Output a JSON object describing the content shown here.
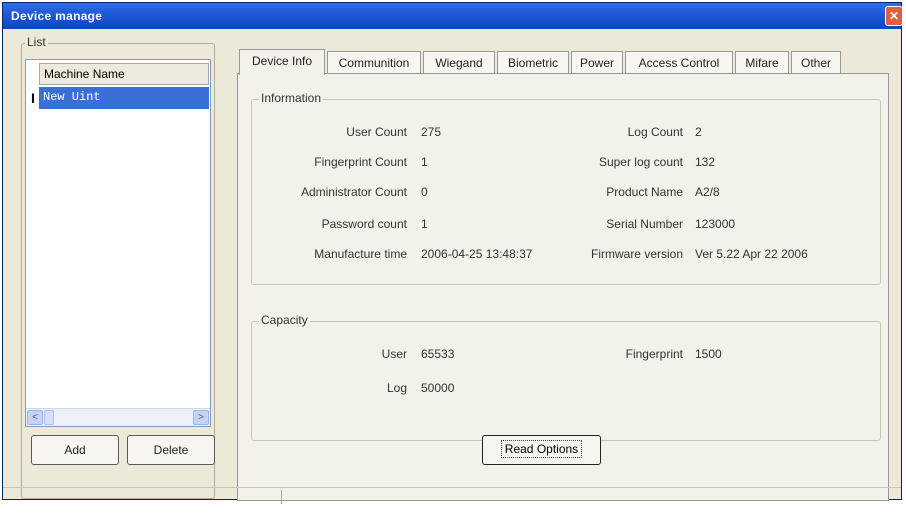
{
  "window": {
    "title": "Device manage",
    "close_glyph": "✕"
  },
  "list": {
    "legend": "List",
    "column_header": "Machine Name",
    "items": [
      {
        "label": "New Uint",
        "selected": true,
        "marker": "I"
      }
    ],
    "scroll_left": "<",
    "scroll_right": ">",
    "add_label": "Add",
    "delete_label": "Delete"
  },
  "tabs": [
    {
      "label": "Device Info",
      "active": true
    },
    {
      "label": "Communition",
      "active": false
    },
    {
      "label": "Wiegand",
      "active": false
    },
    {
      "label": "Biometric",
      "active": false
    },
    {
      "label": "Power",
      "active": false
    },
    {
      "label": "Access Control",
      "active": false
    },
    {
      "label": "Mifare",
      "active": false
    },
    {
      "label": "Other",
      "active": false
    }
  ],
  "information": {
    "legend": "Information",
    "user_count": {
      "label": "User Count",
      "value": "275"
    },
    "fingerprint_count": {
      "label": "Fingerprint Count",
      "value": "1"
    },
    "administrator_count": {
      "label": "Administrator Count",
      "value": "0"
    },
    "password_count": {
      "label": "Password count",
      "value": "1"
    },
    "manufacture_time": {
      "label": "Manufacture time",
      "value": "2006-04-25 13:48:37"
    },
    "log_count": {
      "label": "Log Count",
      "value": "2"
    },
    "super_log_count": {
      "label": "Super log count",
      "value": "132"
    },
    "product_name": {
      "label": "Product Name",
      "value": "A2/8"
    },
    "serial_number": {
      "label": "Serial Number",
      "value": "123000"
    },
    "firmware_version": {
      "label": "Firmware version",
      "value": "Ver 5.22 Apr 22 2006"
    }
  },
  "capacity": {
    "legend": "Capacity",
    "user": {
      "label": "User",
      "value": "65533"
    },
    "log": {
      "label": "Log",
      "value": "50000"
    },
    "fingerprint": {
      "label": "Fingerprint",
      "value": "1500"
    }
  },
  "read_options_label": "Read Options",
  "colors": {
    "titlebar": "#1f5ad6",
    "selection": "#3a6fd6",
    "window_bg": "#ece9d8"
  }
}
